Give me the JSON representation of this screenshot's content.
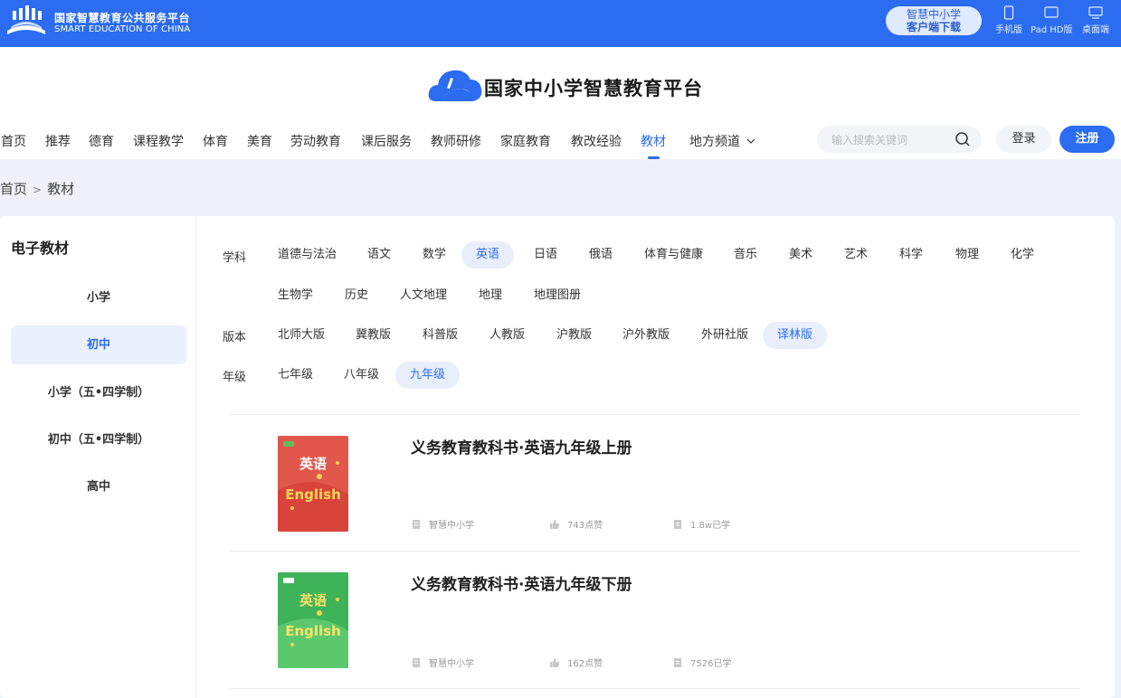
{
  "topbar": {
    "brand_cn": "国家智慧教育公共服务平台",
    "brand_en": "SMART EDUCATION OF CHINA",
    "download_line1": "智慧中小学",
    "download_line2": "客户端下载",
    "devices": [
      "手机版",
      "Pad HD版",
      "桌面端"
    ]
  },
  "header": {
    "platform_title": "国家中小学智慧教育平台",
    "nav": [
      "首页",
      "推荐",
      "德育",
      "课程教学",
      "体育",
      "美育",
      "劳动教育",
      "课后服务",
      "教师研修",
      "家庭教育",
      "教改经验",
      "教材",
      "地方频道"
    ],
    "active_nav": "教材",
    "search_placeholder": "输入搜索关键词",
    "login": "登录",
    "register": "注册"
  },
  "breadcrumb": {
    "home": "首页",
    "sep": ">",
    "current": "教材"
  },
  "sidebar": {
    "title": "电子教材",
    "items": [
      "小学",
      "初中",
      "小学（五•四学制）",
      "初中（五•四学制）",
      "高中"
    ],
    "active": "初中"
  },
  "filters": {
    "subject_label": "学科",
    "subjects": [
      "道德与法治",
      "语文",
      "数学",
      "英语",
      "日语",
      "俄语",
      "体育与健康",
      "音乐",
      "美术",
      "艺术",
      "科学",
      "物理",
      "化学",
      "生物学",
      "历史",
      "人文地理",
      "地理",
      "地理图册"
    ],
    "subject_active": "英语",
    "edition_label": "版本",
    "editions": [
      "北师大版",
      "冀教版",
      "科普版",
      "人教版",
      "沪教版",
      "沪外教版",
      "外研社版",
      "译林版"
    ],
    "edition_active": "译林版",
    "grade_label": "年级",
    "grades": [
      "七年级",
      "八年级",
      "九年级"
    ],
    "grade_active": "九年级"
  },
  "books": [
    {
      "title": "义务教育教科书·英语九年级上册",
      "publisher": "智慧中小学",
      "likes": "743点赞",
      "learned": "1.8w已学",
      "cover_color": "#e2574c",
      "cover_text": "英语",
      "cover_en": "English"
    },
    {
      "title": "义务教育教科书·英语九年级下册",
      "publisher": "智慧中小学",
      "likes": "162点赞",
      "learned": "7526已学",
      "cover_color": "#3fb35a",
      "cover_text": "英语",
      "cover_en": "English"
    }
  ]
}
